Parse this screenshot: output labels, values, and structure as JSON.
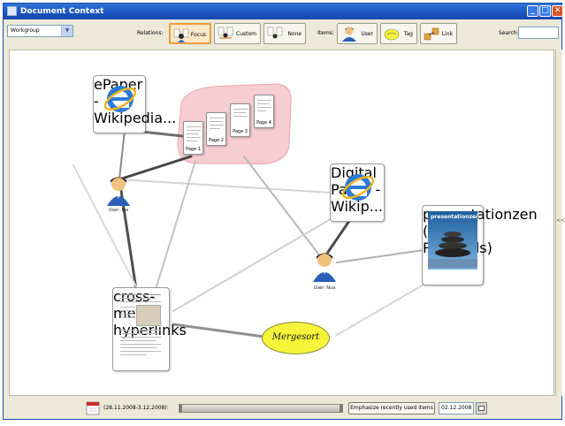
{
  "window": {
    "title": "Document Context"
  },
  "toolbar": {
    "workspace_value": "Workgroup",
    "relations_label": "Relations:",
    "relations": [
      {
        "label": "Focus",
        "active": true
      },
      {
        "label": "Custom",
        "active": false
      },
      {
        "label": "None",
        "active": false
      }
    ],
    "items_label": "Items:",
    "items": [
      {
        "label": "User"
      },
      {
        "label": "Tag"
      },
      {
        "label": "Link"
      }
    ],
    "search_label": "Search:",
    "search_value": ""
  },
  "graph": {
    "epaper_label": "ePaper - Wikipedia...",
    "pages": [
      "Page 1",
      "Page 2",
      "Page 3",
      "Page 4"
    ],
    "user1_label": "User: bia",
    "digital_paper_label": "Digital Paper - Wikip...",
    "presentation_label_1": "presentationzen",
    "presentation_label_2": "(Garr Reynolds)",
    "presentation_title": "presentationzen",
    "user2_label": "User: Nua",
    "crossmedia_label": "cross-media hyperlinks",
    "tag_label": "Mergesort"
  },
  "rightstrip": {
    "toggle": "<<"
  },
  "bottom": {
    "range_label": "(28.11.2008-3.12.2008):",
    "emphasize_button": "Emphasize recently used items",
    "date_value": "02.12.2008"
  },
  "colors": {
    "tag_fill": "#f5f43a",
    "focus_border": "#f09c3c",
    "title_bar": "#1a53bf"
  }
}
